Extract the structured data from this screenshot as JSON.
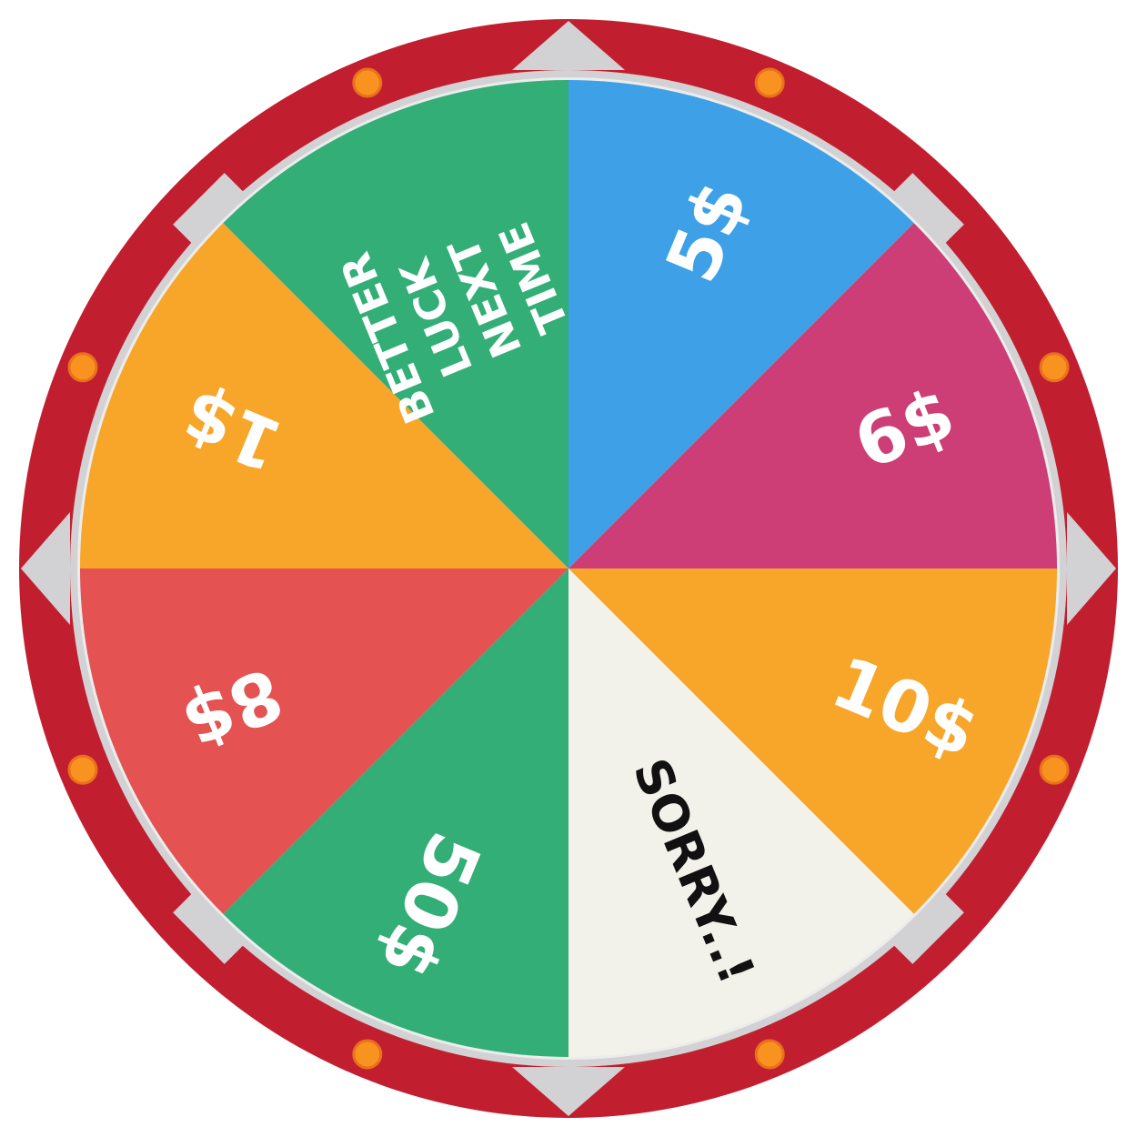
{
  "wheel": {
    "colors": {
      "rim": "#c11f30",
      "bezel": "#d2d2d4",
      "bezel_light": "#ececed",
      "lamp": "#f7931e",
      "lamp_ring": "#e9711c"
    },
    "segments": [
      {
        "id": "5-dollar",
        "label": "5$",
        "color": "#3ea0e6",
        "text_color": "#ffffff"
      },
      {
        "id": "6-dollar",
        "label": "6$",
        "color": "#cc3e75",
        "text_color": "#ffffff"
      },
      {
        "id": "10-dollar",
        "label": "10$",
        "color": "#f8a62a",
        "text_color": "#ffffff"
      },
      {
        "id": "sorry",
        "label": "SORRY..!",
        "color": "#f2f1ea",
        "text_color": "#111111"
      },
      {
        "id": "50-dollar",
        "label": "50$",
        "color": "#33ae76",
        "text_color": "#ffffff"
      },
      {
        "id": "8-dollar",
        "label": "8$",
        "color": "#e55252",
        "text_color": "#ffffff"
      },
      {
        "id": "1-dollar",
        "label": "1$",
        "color": "#f8a62a",
        "text_color": "#ffffff"
      },
      {
        "id": "better-luck",
        "label": "BETTER LUCK NEXT TIME",
        "color": "#33ae76",
        "text_color": "#ffffff"
      }
    ]
  }
}
